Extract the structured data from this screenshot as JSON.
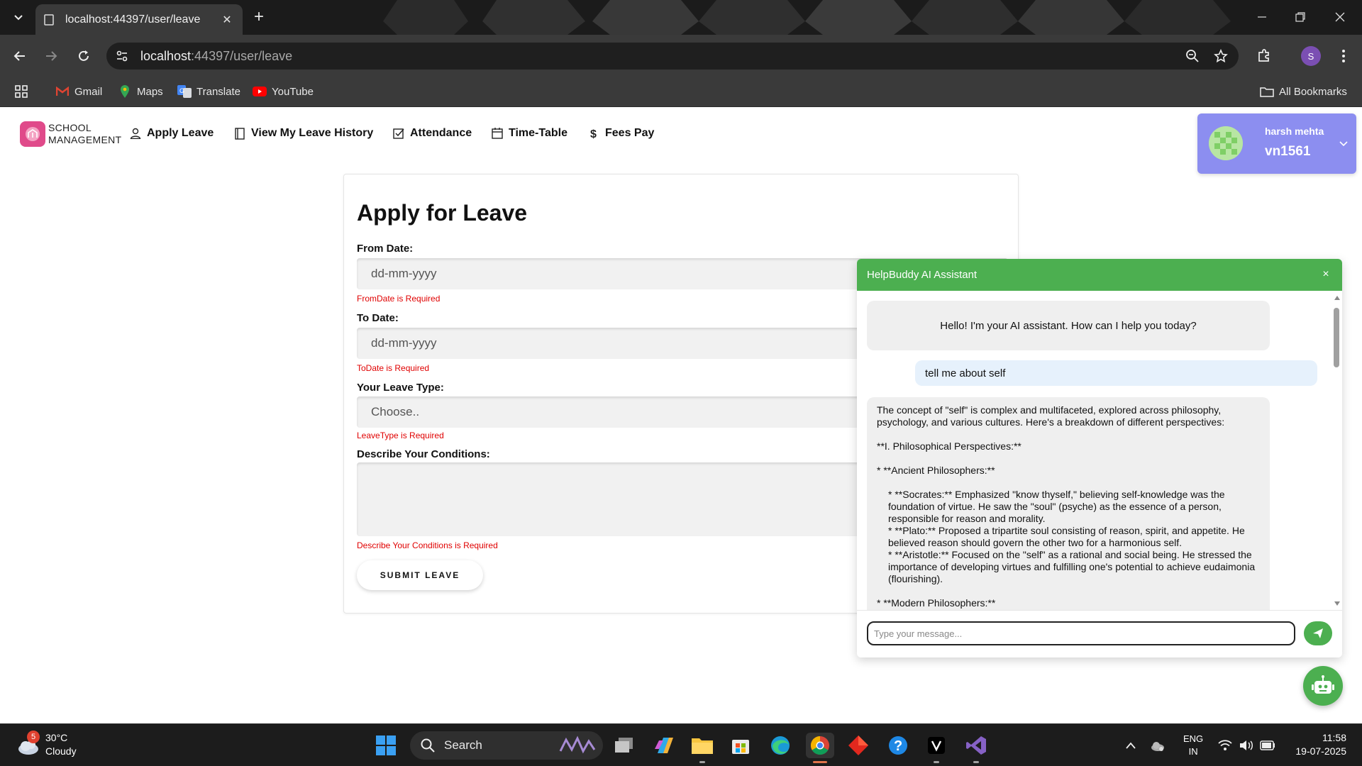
{
  "browser": {
    "tab_title": "localhost:44397/user/leave",
    "url_host": "localhost",
    "url_path": ":44397/user/leave",
    "bookmarks": [
      {
        "label": "Gmail",
        "icon": "gmail-icon"
      },
      {
        "label": "Maps",
        "icon": "maps-icon"
      },
      {
        "label": "Translate",
        "icon": "translate-icon"
      },
      {
        "label": "YouTube",
        "icon": "youtube-icon"
      }
    ],
    "all_bookmarks": "All Bookmarks",
    "profile_initial": "S"
  },
  "app": {
    "brand_line1": "SCHOOL",
    "brand_line2": "MANAGEMENT",
    "nav": [
      {
        "label": "Apply Leave",
        "icon": "user-icon"
      },
      {
        "label": "View My Leave History",
        "icon": "book-icon"
      },
      {
        "label": "Attendance",
        "icon": "checkbox-icon"
      },
      {
        "label": "Time-Table",
        "icon": "calendar-icon"
      },
      {
        "label": "Fees Pay",
        "icon": "dollar-icon"
      }
    ],
    "user": {
      "name": "harsh mehta",
      "id": "vn1561"
    }
  },
  "form": {
    "title": "Apply for Leave",
    "from_label": "From Date:",
    "from_placeholder": "dd-mm-yyyy",
    "from_error": "FromDate is Required",
    "to_label": "To Date:",
    "to_placeholder": "dd-mm-yyyy",
    "to_error": "ToDate is Required",
    "type_label": "Your Leave Type:",
    "type_value": "Choose..",
    "type_error": "LeaveType is Required",
    "desc_label": "Describe Your Conditions:",
    "desc_error": "Describe Your Conditions is Required",
    "submit": "SUBMIT LEAVE"
  },
  "chat": {
    "title": "HelpBuddy AI Assistant",
    "close": "×",
    "greeting": "Hello! I'm your AI assistant. How can I help you today?",
    "user_message": "tell me about self",
    "response": [
      "The concept of \"self\" is complex and multifaceted, explored across philosophy, psychology, and various cultures. Here's a breakdown of different perspectives:",
      "**I. Philosophical Perspectives:**",
      "*   **Ancient Philosophers:**",
      "    *   **Socrates:** Emphasized \"know thyself,\" believing self-knowledge was the foundation of virtue. He saw the \"soul\" (psyche) as the essence of a person, responsible for reason and morality.",
      "    *   **Plato:** Proposed a tripartite soul consisting of reason, spirit, and appetite. He believed reason should govern the other two for a harmonious self.",
      "    *   **Aristotle:** Focused on the \"self\" as a rational and social being. He stressed the importance of developing virtues and fulfilling one's potential to achieve eudaimonia (flourishing).",
      "*   **Modern Philosophers:**"
    ],
    "input_placeholder": "Type your message..."
  },
  "taskbar": {
    "weather_temp": "30°C",
    "weather_desc": "Cloudy",
    "weather_badge": "5",
    "search": "Search",
    "lang1": "ENG",
    "lang2": "IN",
    "time": "11:58",
    "date": "19-07-2025"
  },
  "colors": {
    "chat_green": "#4caf50",
    "user_card": "#8c8ef0",
    "error_red": "#e00000",
    "brand_pink": "#e04a8a"
  }
}
